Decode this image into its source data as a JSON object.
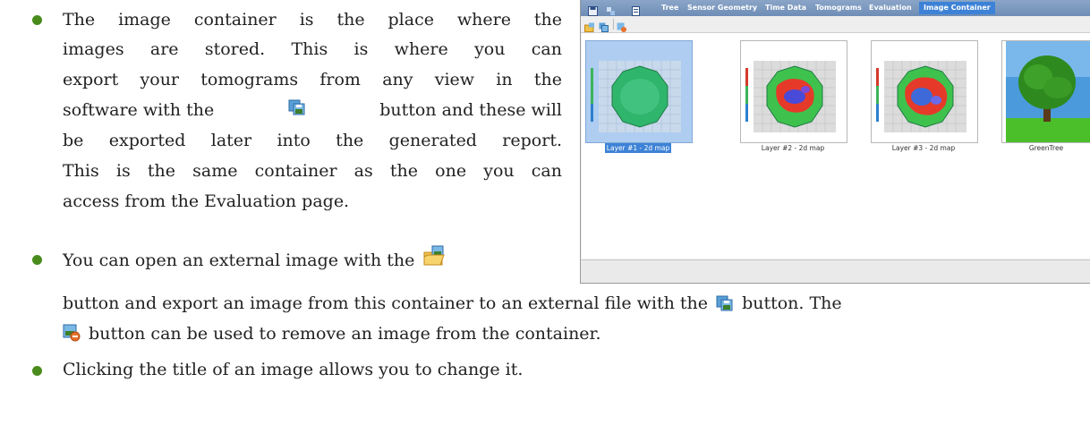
{
  "doc": {
    "p1": [
      "The image container is the place where the",
      "images are stored. This is where you can",
      "export your tomograms from any view in the",
      "software with the",
      "button and these will",
      "be exported later into the generated report.",
      "This is the same container as the one you can",
      "access from the Evaluation page."
    ],
    "p2_a": "You can open an external image with the",
    "p2_b": "button and export an image from this container to an external file with the",
    "p2_c": "button. The",
    "p2_d": "button can be used to remove an image from the container.",
    "p3": "Clicking the title of an image allows you to change it."
  },
  "app": {
    "tabs": [
      "Tree",
      "Sensor Geometry",
      "Time Data",
      "Tomograms",
      "Evaluation",
      "Image Container"
    ],
    "active_tab": "Image Container",
    "images": [
      {
        "title": "Layer #1 - 2d map"
      },
      {
        "title": "Layer #2 - 2d map"
      },
      {
        "title": "Layer #3 - 2d map"
      },
      {
        "title": "GreenTree"
      }
    ]
  },
  "colors": {
    "bullet": "#4a8c1c",
    "active_tab": "#3d82d6",
    "selection": "#aecdf0"
  },
  "icons": [
    "export-image-icon",
    "open-image-icon",
    "remove-image-icon"
  ]
}
